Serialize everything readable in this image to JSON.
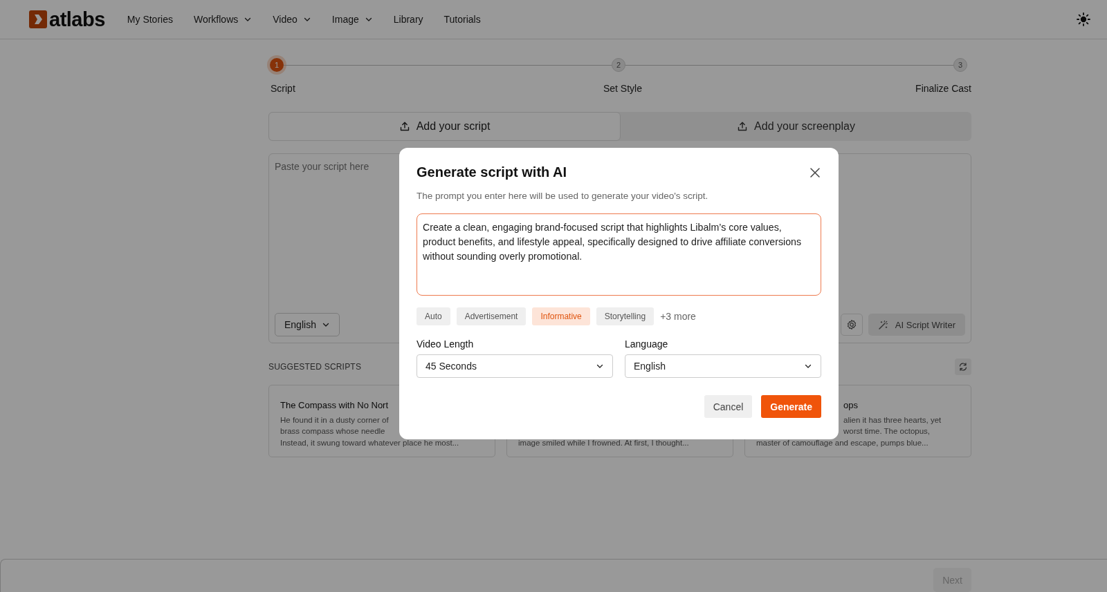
{
  "nav": {
    "logo": "atlabs",
    "items": [
      {
        "label": "My Stories",
        "dropdown": false
      },
      {
        "label": "Workflows",
        "dropdown": true
      },
      {
        "label": "Video",
        "dropdown": true
      },
      {
        "label": "Image",
        "dropdown": true
      },
      {
        "label": "Library",
        "dropdown": false
      },
      {
        "label": "Tutorials",
        "dropdown": false
      }
    ]
  },
  "stepper": [
    {
      "number": "1",
      "label": "Script",
      "selected": true
    },
    {
      "number": "2",
      "label": "Set Style",
      "selected": false
    },
    {
      "number": "3",
      "label": "Finalize Cast",
      "selected": false
    }
  ],
  "script_tabs": [
    {
      "label": "Add your script",
      "selected": true
    },
    {
      "label": "Add your screenplay",
      "selected": false
    }
  ],
  "script_editor": {
    "placeholder": "Paste your script here",
    "language": "English",
    "ai_button": "AI Script Writer"
  },
  "suggested": {
    "heading": "SUGGESTED SCRIPTS",
    "cards": [
      {
        "title": "The Compass with No Nort",
        "lines": [
          "He found it in a dusty corner of",
          "brass compass whose needle",
          "Instead, it swung toward whatever place he most..."
        ]
      },
      {
        "lines": [
          "image smiled while I frowned. At first, I thought..."
        ]
      },
      {
        "title": "ops",
        "lines": [
          "alien it has three hearts, yet",
          "worst time. The octopus,",
          "master of camouflage and escape, pumps blue..."
        ]
      }
    ]
  },
  "footer": {
    "next": {
      "label": "Next",
      "disabled": true
    }
  },
  "modal": {
    "title": "Generate script with AI",
    "description": "The prompt you enter here will be used to generate your video's script.",
    "prompt": "Create a clean, engaging brand-focused script that highlights Libalm’s core values, product benefits, and lifestyle appeal, specifically designed to drive affiliate conversions without sounding overly promotional.",
    "styles": [
      {
        "label": "Auto",
        "selected": false
      },
      {
        "label": "Advertisement",
        "selected": false
      },
      {
        "label": "Informative",
        "selected": true
      },
      {
        "label": "Storytelling",
        "selected": false
      }
    ],
    "more": "+3 more",
    "video_length": {
      "label": "Video Length",
      "value": "45 Seconds"
    },
    "language": {
      "label": "Language",
      "value": "English"
    },
    "buttons": [
      {
        "label": "Cancel",
        "kind": "secondary"
      },
      {
        "label": "Generate",
        "kind": "primary"
      }
    ]
  }
}
